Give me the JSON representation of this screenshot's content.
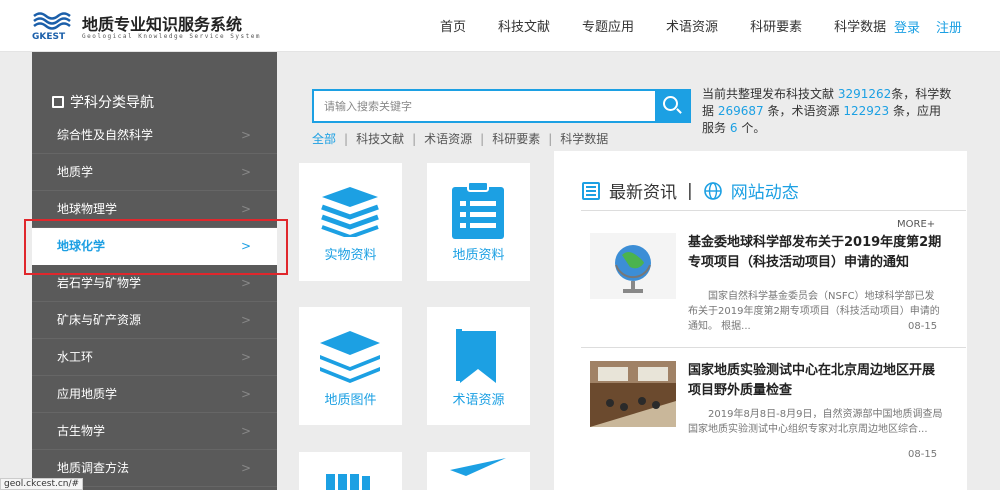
{
  "header": {
    "logo_abbr": "GKEST",
    "logo_cn": "地质专业知识服务系统",
    "logo_en": "Geological Knowledge Service System",
    "nav": [
      "首页",
      "科技文献",
      "专题应用",
      "术语资源",
      "科研要素",
      "科学数据"
    ],
    "login": "登录",
    "register": "注册"
  },
  "sidebar": {
    "title": "学科分类导航",
    "items": [
      "综合性及自然科学",
      "地质学",
      "地球物理学",
      "地球化学",
      "岩石学与矿物学",
      "矿床与矿产资源",
      "水工环",
      "应用地质学",
      "古生物学",
      "地质调查方法"
    ],
    "active_index": 3
  },
  "search": {
    "placeholder": "请输入搜索关键字",
    "filters": [
      "全部",
      "科技文献",
      "术语资源",
      "科研要素",
      "科学数据"
    ]
  },
  "stats": {
    "t1": "当前共整理发布科技文献",
    "n1": "3291262",
    "t2": "条，科学数据",
    "n2": "269687",
    "t3": "条，术语资源",
    "n3": "122923",
    "t4": "条，应用服务",
    "n4": "6",
    "t5": "个。"
  },
  "tiles": [
    "实物资料",
    "地质资料",
    "地质图件",
    "术语资源"
  ],
  "news": {
    "tab1": "最新资讯",
    "tab2": "网站动态",
    "more": "MORE+",
    "items": [
      {
        "title": "基金委地球科学部发布关于2019年度第2期专项项目（科技活动项目）申请的通知",
        "summary": "国家自然科学基金委员会（NSFC）地球科学部已发布关于2019年度第2期专项项目（科技活动项目）申请的通知。   根据...",
        "date": "08-15"
      },
      {
        "title": "国家地质实验测试中心在北京周边地区开展项目野外质量检查",
        "summary": "2019年8月8日-8月9日，自然资源部中国地质调查局国家地质实验测试中心组织专家对北京周边地区综合...",
        "date": "08-15"
      }
    ]
  },
  "status_url": "geol.ckcest.cn/#",
  "colors": {
    "accent": "#1ca0e3",
    "sidebar": "#5a5a5a",
    "highlight": "#e0272c"
  }
}
